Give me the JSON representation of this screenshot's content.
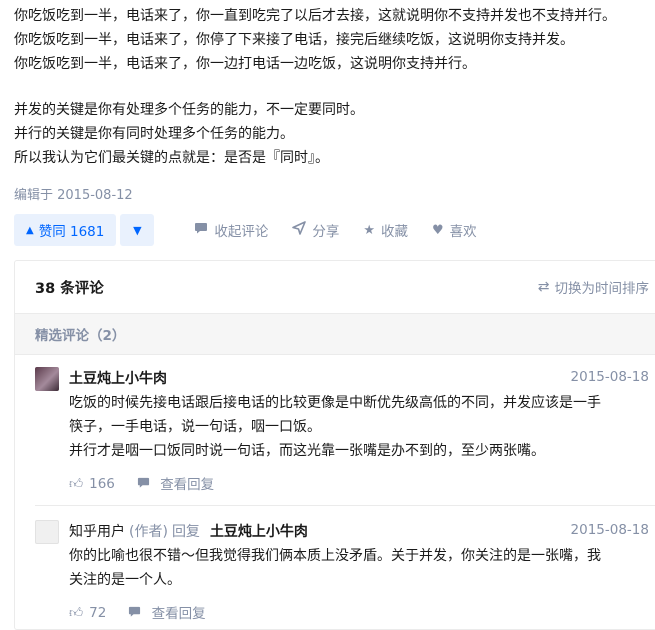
{
  "answer": {
    "lines": [
      "你吃饭吃到一半，电话来了，你一直到吃完了以后才去接，这就说明你不支持并发也不支持并行。",
      "你吃饭吃到一半，电话来了，你停了下来接了电话，接完后继续吃饭，这说明你支持并发。",
      "你吃饭吃到一半，电话来了，你一边打电话一边吃饭，这说明你支持并行。",
      "并发的关键是你有处理多个任务的能力，不一定要同时。",
      "并行的关键是你有同时处理多个任务的能力。",
      "所以我认为它们最关键的点就是：是否是『同时』。"
    ],
    "edited": "编辑于 2015-08-12"
  },
  "actions": {
    "vote_up": "赞同 1681",
    "collapse_comments": "收起评论",
    "share": "分享",
    "collect": "收藏",
    "like": "喜欢"
  },
  "comments": {
    "count": "38 条评论",
    "switch_order": "切换为时间排序",
    "featured": "精选评论（2）",
    "items": [
      {
        "author": "土豆炖上小牛肉",
        "date": "2015-08-18",
        "lines": [
          "吃饭的时候先接电话跟后接电话的比较更像是中断优先级高低的不同，并发应该是一手",
          "筷子，一手电话，说一句话，咽一口饭。",
          "并行才是咽一口饭同时说一句话，而这光靠一张嘴是办不到的，至少两张嘴。"
        ],
        "likes": "166",
        "view_reply": "查看回复"
      },
      {
        "author": "知乎用户",
        "role": "(作者)",
        "reply_word": "回复",
        "target": "土豆炖上小牛肉",
        "date": "2015-08-18",
        "lines": [
          "你的比喻也很不错～但我觉得我们俩本质上没矛盾。关于并发，你关注的是一张嘴，我",
          "关注的是一个人。"
        ],
        "likes": "72",
        "view_reply": "查看回复"
      }
    ]
  }
}
